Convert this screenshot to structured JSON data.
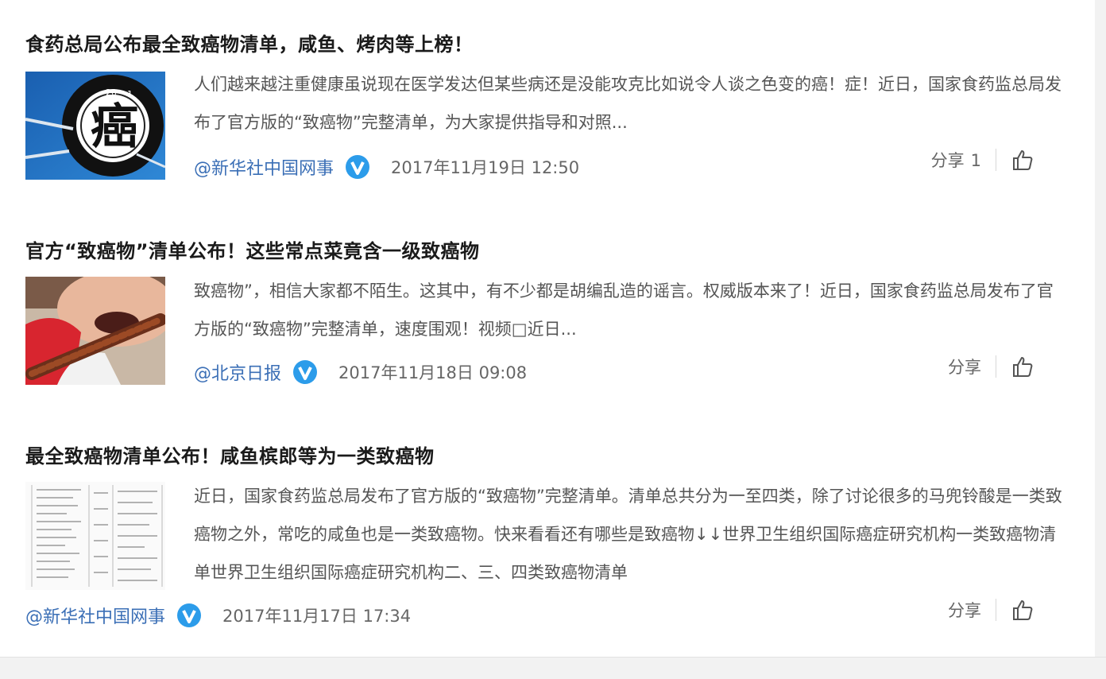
{
  "articles": [
    {
      "title": "食药总局公布最全致癌物清单，咸鱼、烤肉等上榜！",
      "excerpt": "人们越来越注重健康虽说现在医学发达但某些病还是没能攻克比如说令人谈之色变的癌！症！近日，国家食药监总局发布了官方版的“致癌物”完整清单，为大家提供指导和对照...",
      "author": "@新华社中国网事",
      "date": "2017年11月19日 12:50",
      "share_label": "分享",
      "share_count": "1",
      "thumb_char": "癌",
      "thumb_numbers": [
        "20",
        "1"
      ]
    },
    {
      "title": "官方“致癌物”清单公布！这些常点菜竟含一级致癌物",
      "excerpt": "致癌物”，相信大家都不陌生。这其中，有不少都是胡编乱造的谣言。权威版本来了！近日，国家食药监总局发布了官方版的“致癌物”完整清单，速度围观！视频□近日...",
      "author": "@北京日报",
      "date": "2017年11月18日 09:08",
      "share_label": "分享",
      "share_count": ""
    },
    {
      "title": "最全致癌物清单公布！咸鱼槟郎等为一类致癌物",
      "excerpt": "近日，国家食药监总局发布了官方版的“致癌物”完整清单。清单总共分为一至四类，除了讨论很多的马兜铃酸是一类致癌物之外，常吃的咸鱼也是一类致癌物。快来看看还有哪些是致癌物↓↓世界卫生组织国际癌症研究机构一类致癌物清单世界卫生组织国际癌症研究机构二、三、四类致癌物清单",
      "author": "@新华社中国网事",
      "date": "2017年11月17日 17:34",
      "share_label": "分享",
      "share_count": ""
    }
  ],
  "colors": {
    "author_link": "#3b6fb6",
    "verified_badge": "#2c9cea",
    "title": "#1a1a1a",
    "excerpt": "#555555"
  },
  "icons": {
    "verified": "verified-badge-icon",
    "like": "thumbs-up-icon"
  }
}
